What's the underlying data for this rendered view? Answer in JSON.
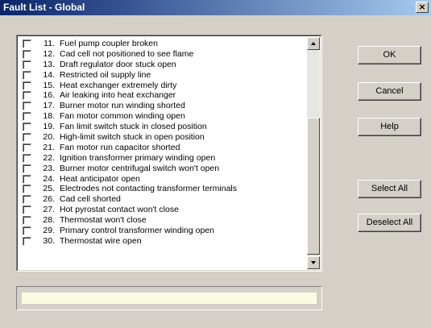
{
  "window": {
    "title": "Fault List - Global",
    "close_glyph": "×"
  },
  "faults": [
    {
      "num": "11.",
      "text": "Fuel pump coupler broken"
    },
    {
      "num": "12.",
      "text": "Cad cell not positioned to see flame"
    },
    {
      "num": "13.",
      "text": "Draft regulator door stuck open"
    },
    {
      "num": "14.",
      "text": "Restricted oil supply line"
    },
    {
      "num": "15.",
      "text": "Heat exchanger extremely dirty"
    },
    {
      "num": "16.",
      "text": "Air leaking into heat exchanger"
    },
    {
      "num": "17.",
      "text": "Burner motor run winding shorted"
    },
    {
      "num": "18.",
      "text": "Fan motor common winding open"
    },
    {
      "num": "19.",
      "text": "Fan limit switch stuck in closed position"
    },
    {
      "num": "20.",
      "text": "High-limit switch stuck in open position"
    },
    {
      "num": "21.",
      "text": "Fan motor run capacitor shorted"
    },
    {
      "num": "22.",
      "text": "Ignition transformer primary winding open"
    },
    {
      "num": "23.",
      "text": "Burner motor centrifugal switch won't open"
    },
    {
      "num": "24.",
      "text": "Heat anticipator open"
    },
    {
      "num": "25.",
      "text": "Electrodes not contacting transformer terminals"
    },
    {
      "num": "26.",
      "text": "Cad cell shorted"
    },
    {
      "num": "27.",
      "text": "Hot pyrostat contact won't close"
    },
    {
      "num": "28.",
      "text": "Thermostat won't close"
    },
    {
      "num": "29.",
      "text": "Primary control transformer winding open"
    },
    {
      "num": "30.",
      "text": "Thermostat wire open"
    }
  ],
  "buttons": {
    "ok": "OK",
    "cancel": "Cancel",
    "help": "Help",
    "select_all": "Select All",
    "deselect_all": "Deselect All"
  },
  "status": {
    "text": ""
  }
}
